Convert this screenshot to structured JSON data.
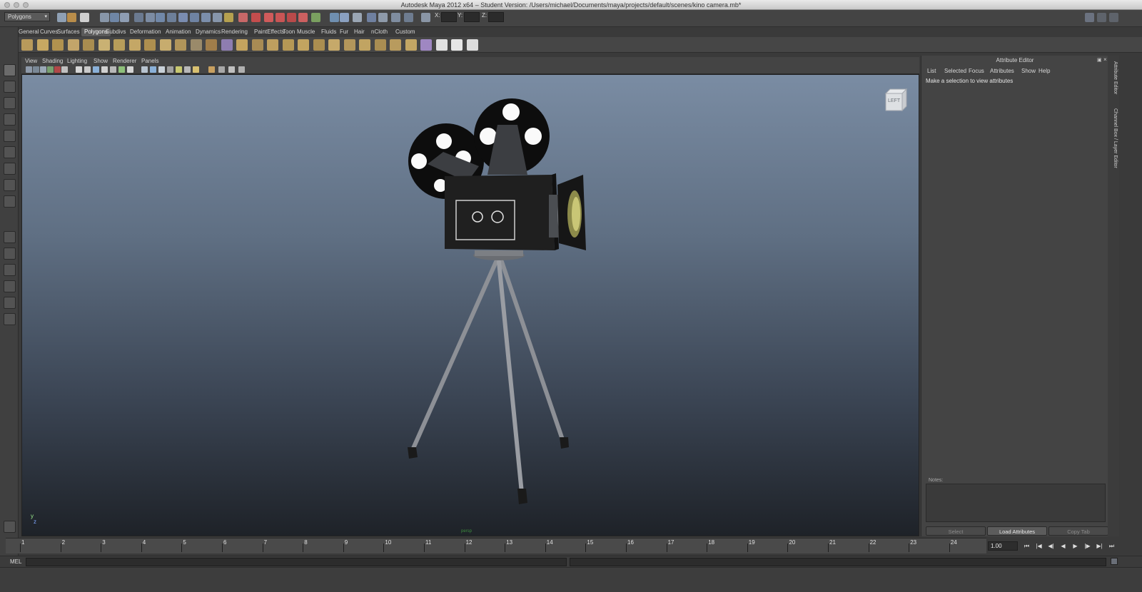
{
  "window": {
    "title": "Autodesk Maya 2012 x64 – Student Version: /Users/michael/Documents/maya/projects/default/scenes/kino camera.mb*"
  },
  "statusline": {
    "mode": "Polygons",
    "x_label": "X:",
    "y_label": "Y:",
    "z_label": "Z:"
  },
  "shelf": {
    "tabs": [
      "General",
      "Curves",
      "Surfaces",
      "Polygons",
      "Subdivs",
      "Deformation",
      "Animation",
      "Dynamics",
      "Rendering",
      "PaintEffects",
      "Toon",
      "Muscle",
      "Fluids",
      "Fur",
      "Hair",
      "nCloth",
      "Custom"
    ],
    "active_tab": "Polygons"
  },
  "panel_menu": [
    "View",
    "Shading",
    "Lighting",
    "Show",
    "Renderer",
    "Panels"
  ],
  "viewport": {
    "viewcube_label": "LEFT",
    "axis_y": "y",
    "axis_z": "z",
    "camera_name": "persp"
  },
  "attribute_editor": {
    "title": "Attribute Editor",
    "menu": [
      "List",
      "Selected",
      "Focus",
      "Attributes",
      "Show",
      "Help"
    ],
    "message": "Make a selection to view attributes",
    "notes_label": "Notes:",
    "buttons": {
      "select": "Select",
      "load": "Load Attributes",
      "copy": "Copy Tab"
    }
  },
  "side_tabs": {
    "attribute_editor": "Attribute Editor",
    "channel_box": "Channel Box / Layer Editor"
  },
  "timeline": {
    "frames": [
      "1",
      "2",
      "3",
      "4",
      "5",
      "6",
      "7",
      "8",
      "9",
      "10",
      "11",
      "12",
      "13",
      "14",
      "15",
      "16",
      "17",
      "18",
      "19",
      "20",
      "21",
      "22",
      "23",
      "24"
    ],
    "current_time": "1.00"
  },
  "playback": [
    "⏮",
    "|◀",
    "◀|",
    "◀",
    "▶",
    "|▶",
    "▶|",
    "⏭"
  ],
  "command_line": {
    "label": "MEL"
  },
  "colors": {
    "background": "#3a3a3a",
    "viewport_top": "#7a8ca3",
    "viewport_bottom": "#1e2228"
  },
  "icons": [
    "select-tool-icon",
    "lasso-tool-icon",
    "paint-select-icon",
    "move-tool-icon",
    "rotate-tool-icon",
    "scale-tool-icon",
    "manipulator-icon",
    "soft-mod-icon",
    "show-manipulator-icon",
    "layout-single-icon",
    "layout-four-icon",
    "layout-side-icon",
    "layout-outliner-icon",
    "layout-graph-icon",
    "layout-hypershade-icon"
  ]
}
